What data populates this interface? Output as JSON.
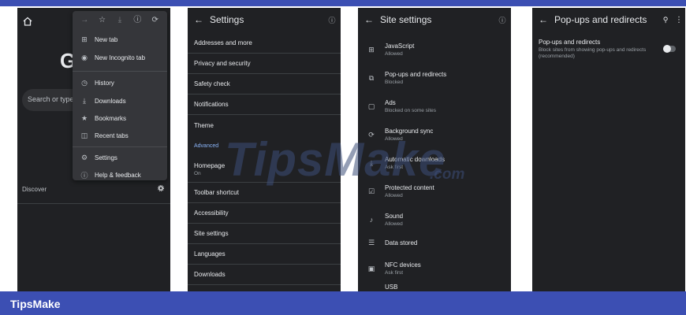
{
  "menu": {
    "toolbar_icons": [
      "forward-icon",
      "star-icon",
      "download-icon",
      "info-icon",
      "refresh-icon"
    ],
    "items": [
      {
        "icon": "new-tab-icon",
        "label": "New tab"
      },
      {
        "icon": "incognito-icon",
        "label": "New Incognito tab"
      },
      {
        "icon": "history-icon",
        "label": "History"
      },
      {
        "icon": "downloads-icon",
        "label": "Downloads"
      },
      {
        "icon": "bookmark-star-icon",
        "label": "Bookmarks"
      },
      {
        "icon": "recent-tabs-icon",
        "label": "Recent tabs"
      },
      {
        "icon": "settings-gear-icon",
        "label": "Settings"
      },
      {
        "icon": "help-icon",
        "label": "Help & feedback"
      }
    ]
  },
  "home": {
    "logo_letter": "G",
    "search_placeholder": "Search or type",
    "discover_label": "Discover"
  },
  "settings": {
    "title": "Settings",
    "rows": [
      {
        "label": "Addresses and more",
        "sub": ""
      },
      {
        "label": "Privacy and security",
        "sub": ""
      },
      {
        "label": "Safety check",
        "sub": ""
      },
      {
        "label": "Notifications",
        "sub": ""
      },
      {
        "label": "Theme",
        "sub": ""
      },
      {
        "label": "Homepage",
        "sub": "On"
      },
      {
        "label": "Toolbar shortcut",
        "sub": ""
      },
      {
        "label": "Accessibility",
        "sub": ""
      },
      {
        "label": "Site settings",
        "sub": ""
      },
      {
        "label": "Languages",
        "sub": ""
      },
      {
        "label": "Downloads",
        "sub": ""
      }
    ],
    "advanced_label": "Advanced"
  },
  "site_settings": {
    "title": "Site settings",
    "rows": [
      {
        "icon": "javascript-icon",
        "name": "JavaScript",
        "status": "Allowed"
      },
      {
        "icon": "popup-icon",
        "name": "Pop-ups and redirects",
        "status": "Blocked"
      },
      {
        "icon": "ads-icon",
        "name": "Ads",
        "status": "Blocked on some sites"
      },
      {
        "icon": "sync-icon",
        "name": "Background sync",
        "status": "Allowed"
      },
      {
        "icon": "download-icon",
        "name": "Automatic downloads",
        "status": "Ask first"
      },
      {
        "icon": "protected-content-icon",
        "name": "Protected content",
        "status": "Allowed"
      },
      {
        "icon": "sound-icon",
        "name": "Sound",
        "status": "Allowed"
      },
      {
        "icon": "storage-icon",
        "name": "Data stored",
        "status": ""
      },
      {
        "icon": "nfc-icon",
        "name": "NFC devices",
        "status": "Ask first"
      },
      {
        "icon": "usb-icon",
        "name": "USB",
        "status": ""
      }
    ]
  },
  "popups": {
    "title": "Pop-ups and redirects",
    "setting_title": "Pop-ups and redirects",
    "setting_desc": "Block sites from showing pop-ups and redirects (recommended)",
    "toggle_on": false
  },
  "watermark": {
    "text": "TipsMake",
    "suffix": ".com"
  },
  "footer": {
    "brand": "TipsMake"
  },
  "colors": {
    "panel_bg": "#202124",
    "menu_bg": "#35363a",
    "brand_bar": "#3c4fb3",
    "accent_link": "#8ab4f8"
  }
}
